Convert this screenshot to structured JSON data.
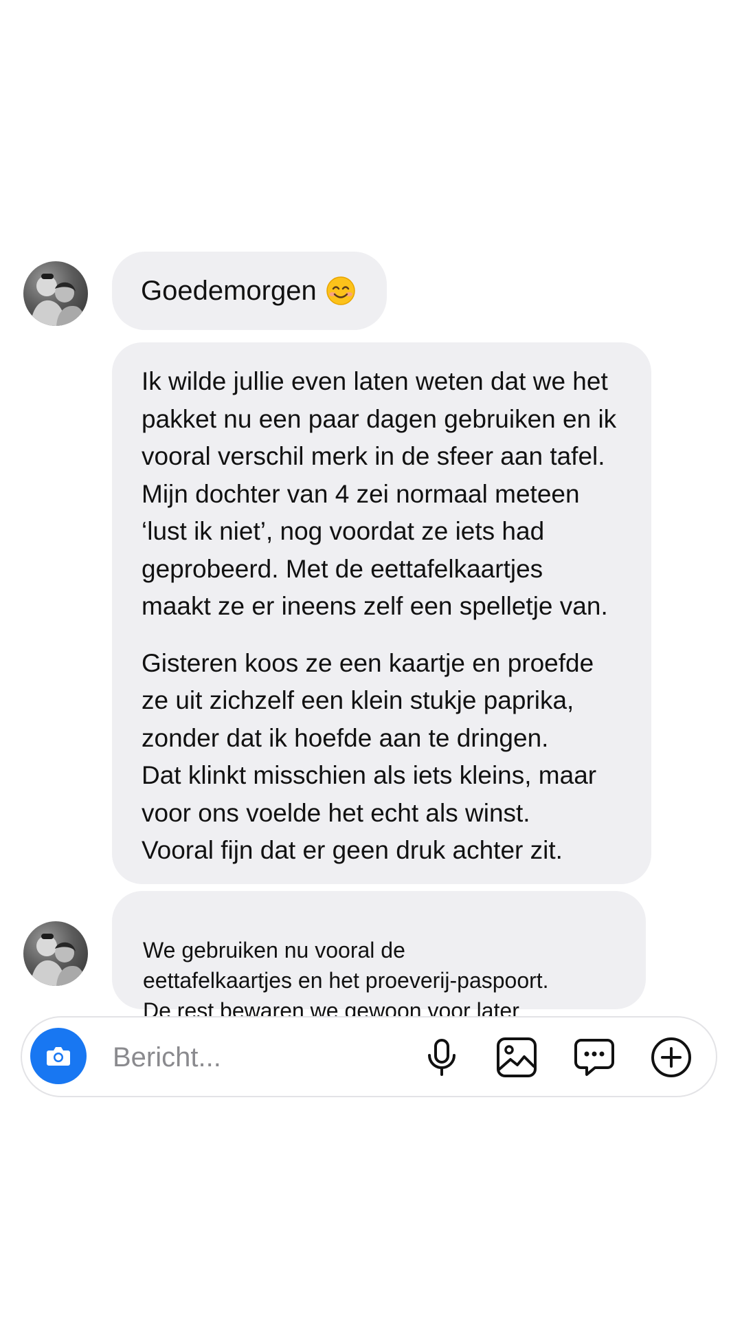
{
  "conversation": {
    "greeting": {
      "text": "Goedemorgen",
      "emoji_icon": "smiling-face-emoji"
    },
    "long_message": {
      "paragraphs": [
        "Ik wilde jullie even laten weten dat we het\npakket nu een paar dagen gebruiken en ik\nvooral verschil merk in de sfeer aan tafel.\nMijn dochter van 4 zei normaal meteen\n‘lust ik niet’, nog voordat ze iets had\ngeprobeerd. Met de eettafelkaartjes\nmaakt ze er ineens zelf een spelletje van.",
        "Gisteren koos ze een kaartje en proefde\nze uit zichzelf een klein stukje paprika,\nzonder dat ik hoefde aan te dringen.\nDat klinkt misschien als iets kleins, maar\nvoor ons voelde het echt als winst.\nVooral fijn dat er geen druk achter zit."
      ]
    },
    "last_message": {
      "text": "We gebruiken nu vooral de\neettafelkaartjes en het proeverij-paspoort.\nDe rest bewaren we gewoon voor later"
    }
  },
  "composer": {
    "placeholder": "Bericht...",
    "camera_icon": "camera-icon",
    "tools": [
      "microphone-icon",
      "gallery-icon",
      "chat-bubble-icon",
      "add-circle-icon"
    ]
  },
  "colors": {
    "bubble_background": "#efeff2",
    "accent_blue": "#1877f2",
    "composer_border": "#e3e3e6",
    "placeholder_text": "#8a8a8e"
  }
}
